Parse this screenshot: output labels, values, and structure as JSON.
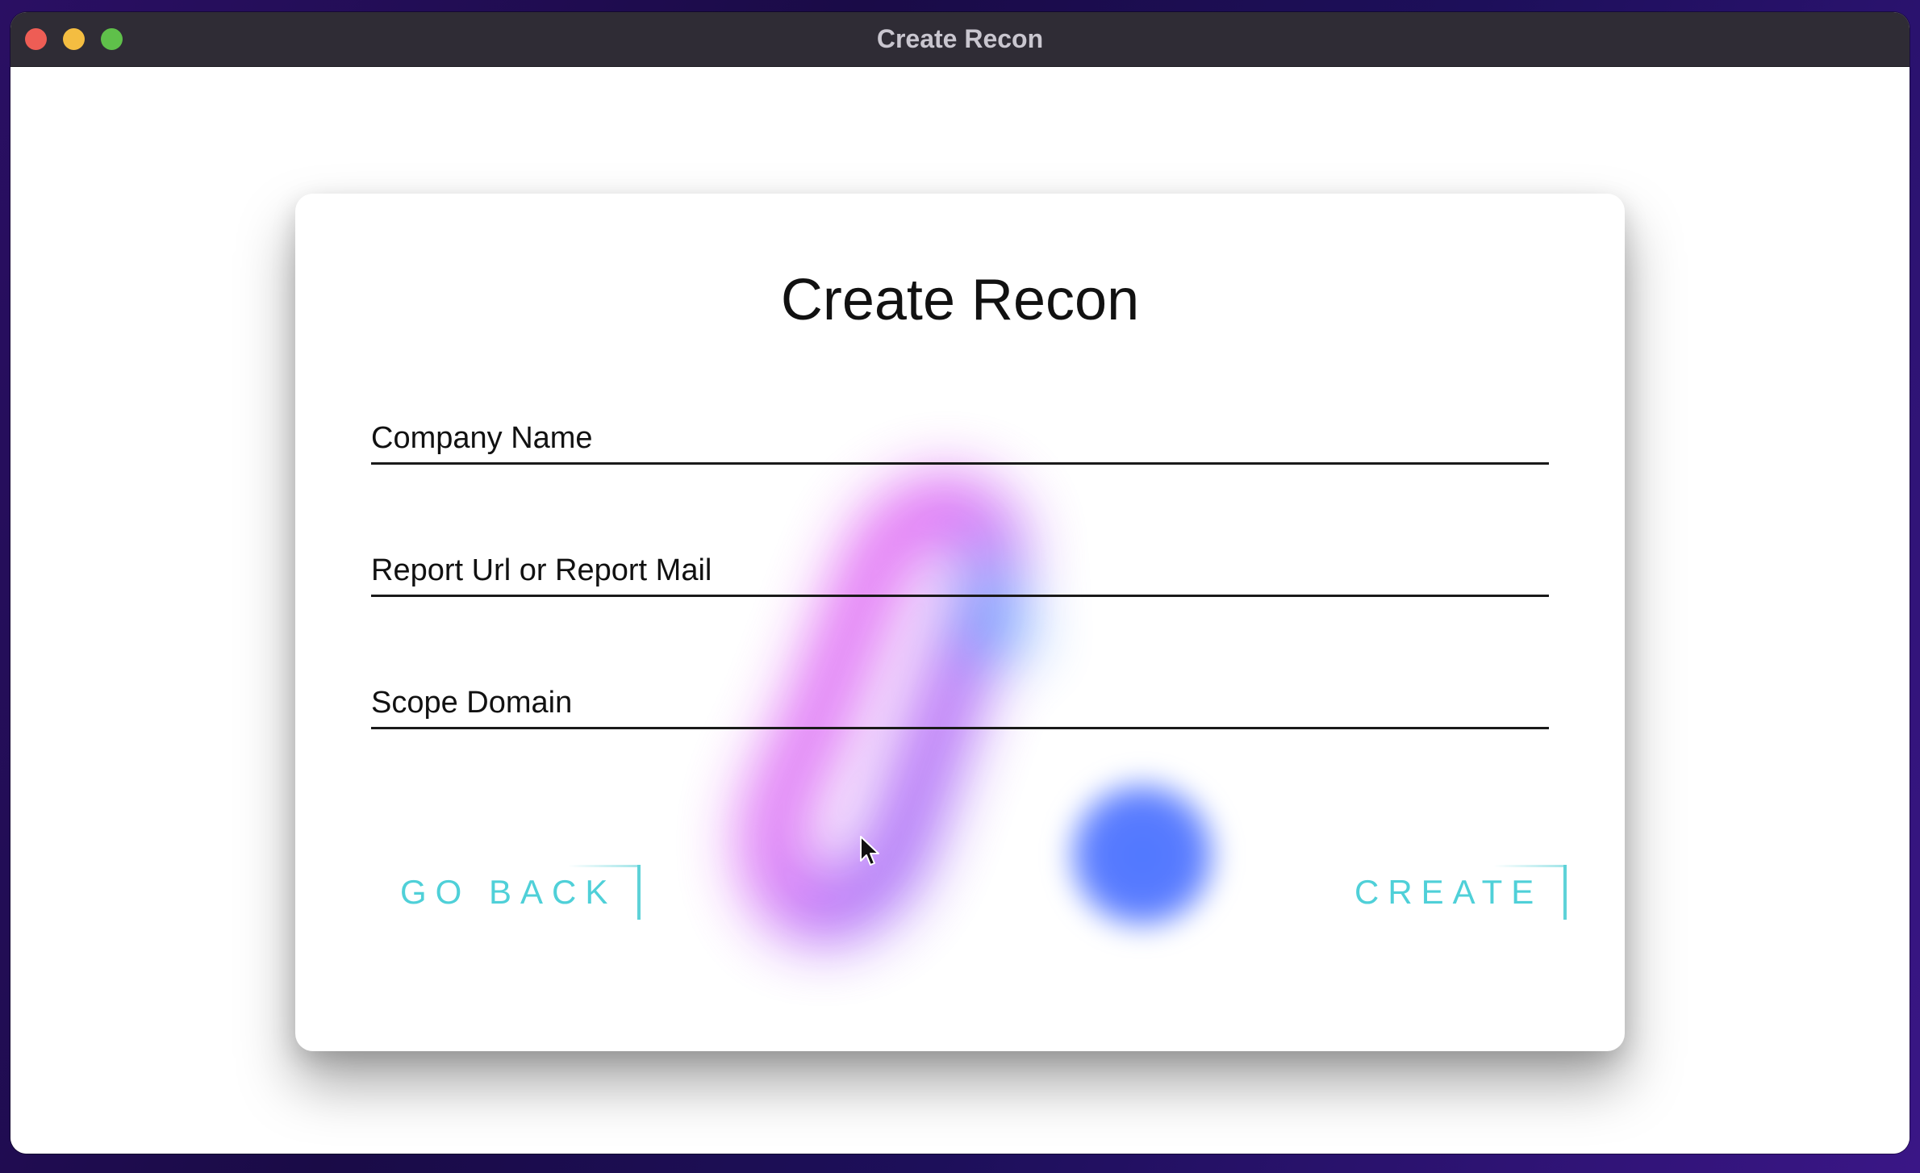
{
  "window": {
    "title": "Create Recon"
  },
  "form": {
    "heading": "Create Recon",
    "fields": [
      {
        "placeholder": "Company Name",
        "value": ""
      },
      {
        "placeholder": "Report Url or Report Mail",
        "value": ""
      },
      {
        "placeholder": "Scope Domain",
        "value": ""
      }
    ],
    "back_label": "GO BACK",
    "create_label": "CREATE"
  },
  "colors": {
    "accent": "#4fd0d8",
    "blob_pink": "#ec5ff0",
    "blob_blue": "#4f77ff"
  }
}
